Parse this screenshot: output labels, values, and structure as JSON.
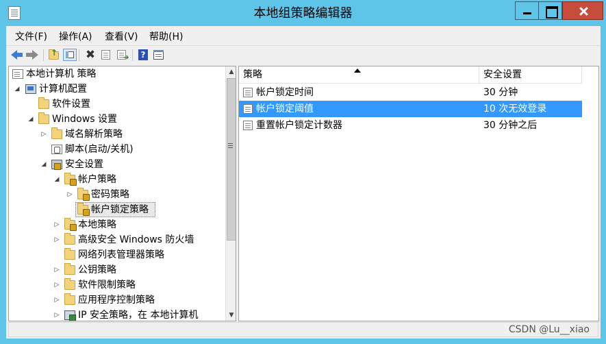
{
  "window": {
    "title": "本地组策略编辑器",
    "controls": [
      "minimize",
      "maximize",
      "close"
    ],
    "close_color": "#c74c3c",
    "frame_color": "#5ec4e8"
  },
  "menubar": {
    "items": [
      "文件(F)",
      "操作(A)",
      "查看(V)",
      "帮助(H)"
    ]
  },
  "toolbar": {
    "icons": [
      "back-icon",
      "forward-icon",
      "up-folder-icon",
      "show-hide-tree-icon",
      "delete-icon",
      "properties-icon",
      "export-list-icon",
      "help-icon",
      "view-icon"
    ]
  },
  "tree": {
    "items": [
      {
        "label": "本地计算机 策略",
        "icon": "policy-doc-icon",
        "expander": ""
      },
      {
        "label": "计算机配置",
        "icon": "computer-icon",
        "expander": "◢"
      },
      {
        "label": "软件设置",
        "icon": "folder-icon",
        "expander": ""
      },
      {
        "label": "Windows 设置",
        "icon": "folder-icon",
        "expander": "◢"
      },
      {
        "label": "域名解析策略",
        "icon": "folder-icon",
        "expander": "▷"
      },
      {
        "label": "脚本(启动/关机)",
        "icon": "script-icon",
        "expander": ""
      },
      {
        "label": "安全设置",
        "icon": "security-icon",
        "expander": "◢"
      },
      {
        "label": "帐户策略",
        "icon": "locked-folder-icon",
        "expander": "◢"
      },
      {
        "label": "密码策略",
        "icon": "locked-folder-icon",
        "expander": "▷"
      },
      {
        "label": "帐户锁定策略",
        "icon": "locked-folder-icon",
        "expander": ""
      },
      {
        "label": "本地策略",
        "icon": "locked-folder-icon",
        "expander": "▷"
      },
      {
        "label": "高级安全 Windows 防火墙",
        "icon": "folder-icon",
        "expander": "▷"
      },
      {
        "label": "网络列表管理器策略",
        "icon": "folder-icon",
        "expander": ""
      },
      {
        "label": "公钥策略",
        "icon": "folder-icon",
        "expander": "▷"
      },
      {
        "label": "软件限制策略",
        "icon": "folder-icon",
        "expander": "▷"
      },
      {
        "label": "应用程序控制策略",
        "icon": "folder-icon",
        "expander": "▷"
      },
      {
        "label": "IP 安全策略，在 本地计算机",
        "icon": "ipsec-icon",
        "expander": "▷"
      }
    ],
    "selected": "帐户锁定策略"
  },
  "list": {
    "columns": [
      "策略",
      "安全设置"
    ],
    "rows": [
      {
        "policy": "帐户锁定时间",
        "setting": "30 分钟"
      },
      {
        "policy": "帐户锁定阈值",
        "setting": "10 次无效登录"
      },
      {
        "policy": "重置帐户锁定计数器",
        "setting": "30 分钟之后"
      }
    ],
    "selected_index": 1,
    "selection_color": "#3399ff"
  },
  "statusbar": {
    "watermark": "CSDN @Lu__xiao"
  }
}
